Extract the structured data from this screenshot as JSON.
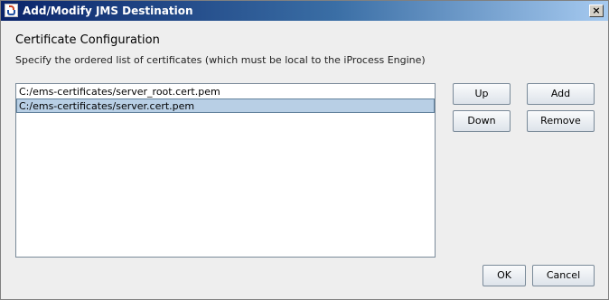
{
  "window": {
    "title": "Add/Modify JMS Destination",
    "close_symbol": "×"
  },
  "section": {
    "title": "Certificate Configuration",
    "description": "Specify the ordered list of certificates (which must be local to the iProcess Engine)"
  },
  "certificates": [
    {
      "path": "C:/ems-certificates/server_root.cert.pem",
      "selected": false
    },
    {
      "path": "C:/ems-certificates/server.cert.pem",
      "selected": true
    }
  ],
  "buttons": {
    "up": "Up",
    "add": "Add",
    "down": "Down",
    "remove": "Remove",
    "ok": "OK",
    "cancel": "Cancel"
  },
  "icons": {
    "app": "java-app-icon",
    "close": "close-icon"
  },
  "colors": {
    "selection_bg": "#b8cfe5",
    "titlebar_start": "#0a246a",
    "titlebar_end": "#a6caf0"
  }
}
